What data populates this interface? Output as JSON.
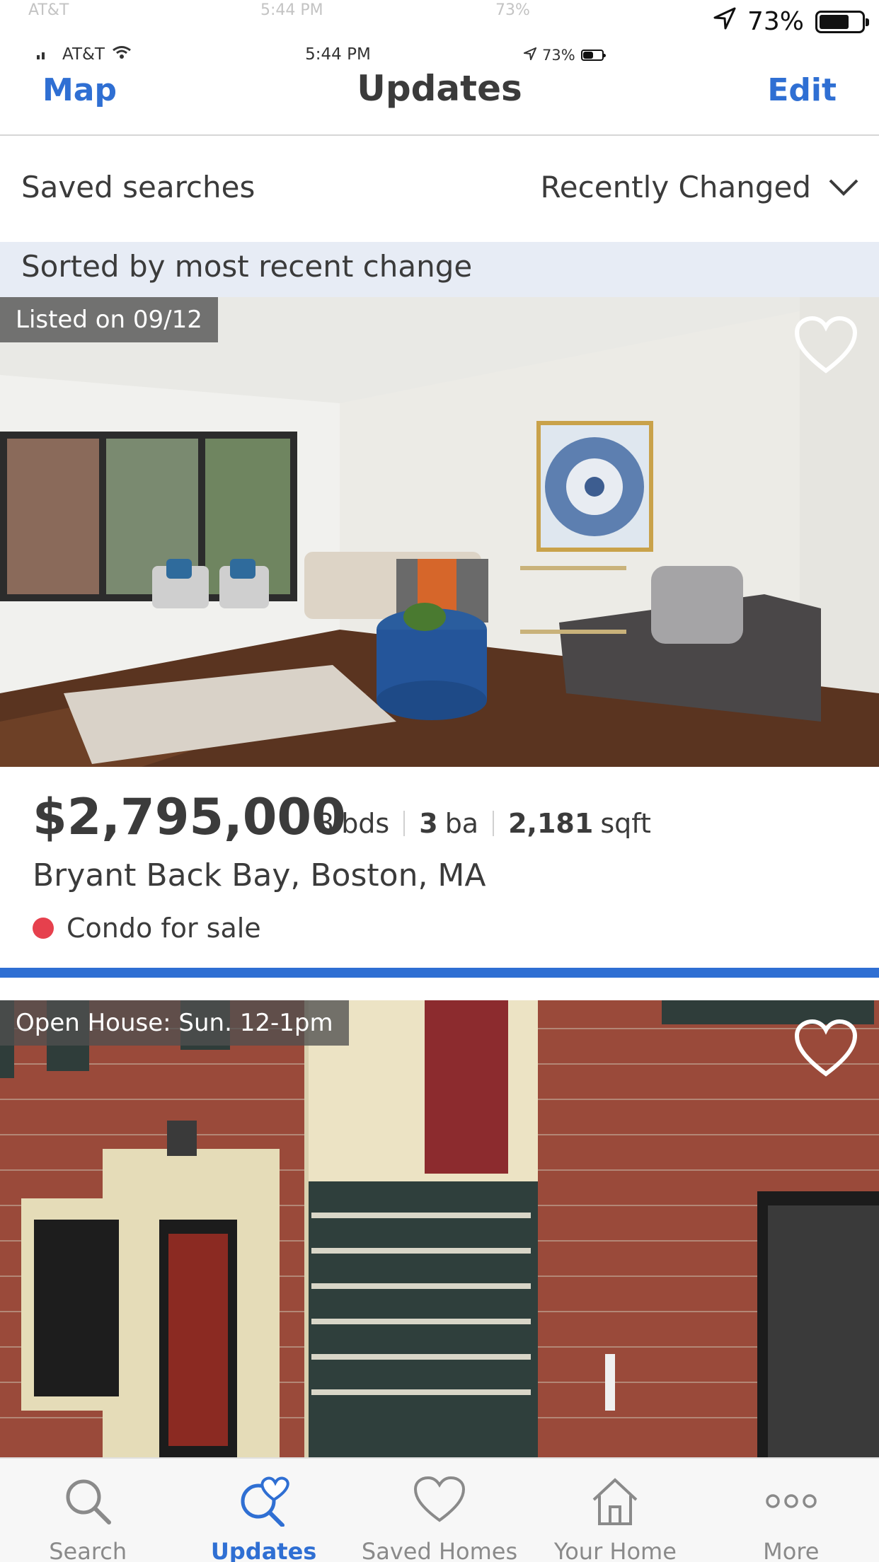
{
  "status_bar": {
    "carrier": "AT&T",
    "time": "5:44 PM",
    "battery": "73%",
    "battery_level": 0.73,
    "ghost_carrier": "AT&T",
    "ghost_time": "5:44 PM",
    "ghost_battery": "73%"
  },
  "nav": {
    "left": "Map",
    "title": "Updates",
    "right": "Edit"
  },
  "filter": {
    "saved_label": "Saved searches",
    "sort_value": "Recently Changed"
  },
  "banner": {
    "text": "Sorted by most recent change"
  },
  "listings": [
    {
      "tag": "Listed on 09/12",
      "price": "$2,795,000",
      "beds_num": "3",
      "beds_unit": "bds",
      "baths_num": "3",
      "baths_unit": "ba",
      "sqft_num": "2,181",
      "sqft_unit": "sqft",
      "address": "Bryant Back Bay, Boston, MA",
      "status": "Condo for sale",
      "status_color": "#e6404d"
    },
    {
      "tag": "Open House: Sun. 12-1pm"
    }
  ],
  "tabs": [
    {
      "label": "Search",
      "icon": "search-icon"
    },
    {
      "label": "Updates",
      "icon": "updates-icon"
    },
    {
      "label": "Saved Homes",
      "icon": "heart-icon"
    },
    {
      "label": "Your Home",
      "icon": "home-icon"
    },
    {
      "label": "More",
      "icon": "more-icon"
    }
  ],
  "colors": {
    "accent": "#2f6fd3",
    "text": "#3b3b3b",
    "banner_bg": "#e7ecf5"
  }
}
